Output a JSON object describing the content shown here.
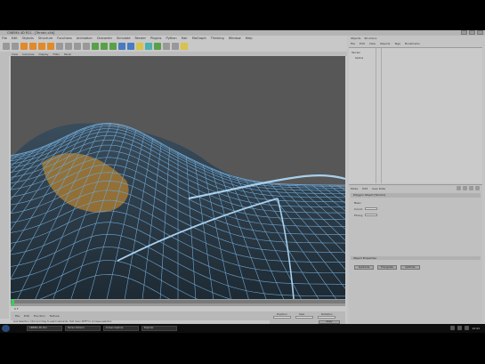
{
  "window": {
    "title": "CINEMA 4D R11 - [Terrain.c4d]",
    "menu": [
      "File",
      "Edit",
      "Objects",
      "Structure",
      "Functions",
      "Animation",
      "Character",
      "Simulate",
      "Render",
      "Plugins",
      "Python",
      "Hair",
      "MoGraph",
      "Thinking",
      "Window",
      "Help"
    ]
  },
  "viewport": {
    "menu": [
      "View",
      "Cameras",
      "Display",
      "Filter",
      "Panel"
    ]
  },
  "timeline": {
    "frame_info": "0 F"
  },
  "material_manager": {
    "menu": [
      "File",
      "Edit",
      "Function",
      "Texture"
    ]
  },
  "coordinates": {
    "headers": [
      "Position",
      "Size",
      "Rotation"
    ],
    "apply": "Apply"
  },
  "object_manager": {
    "tabs": [
      "Objects",
      "Structure"
    ],
    "menu": [
      "File",
      "Edit",
      "View",
      "Objects",
      "Tags",
      "Bookmarks"
    ],
    "items": [
      "Terrain",
      "Spline"
    ]
  },
  "attributes": {
    "menu": [
      "Mode",
      "Edit",
      "User Data"
    ],
    "title": "Polygon Object [Terrain]",
    "rows": [
      "Basic",
      "Coord.",
      "Phong"
    ],
    "section": "Object Properties",
    "buttons": [
      "Subdivide",
      "Triangulate",
      "Optimize"
    ]
  },
  "status_bar": "Live Selection: Click and drag to select elements. Hold down SHIFT to increase selection",
  "taskbar": {
    "tasks": [
      "CINEMA 4D R11",
      "Terrain Tutorial",
      "Screen Capture",
      "Explorer"
    ],
    "clock": "12:41"
  },
  "colors": {
    "interface_grey": "#c8c8c8",
    "viewport_bg": "#575757",
    "wireframe": "#6ea6d2",
    "selection": "#e08a2a"
  }
}
